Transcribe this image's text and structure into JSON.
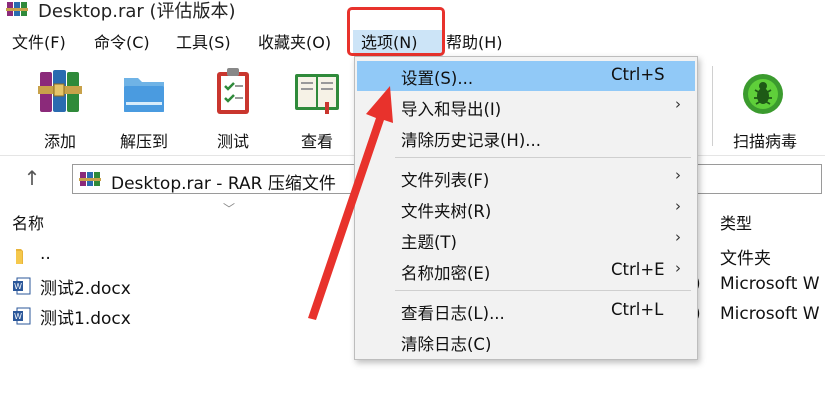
{
  "window": {
    "title": "Desktop.rar (评估版本)"
  },
  "menubar": {
    "items": [
      {
        "label": "文件(F)"
      },
      {
        "label": "命令(C)"
      },
      {
        "label": "工具(S)"
      },
      {
        "label": "收藏夹(O)"
      },
      {
        "label": "选项(N)"
      },
      {
        "label": "帮助(H)"
      }
    ]
  },
  "toolbar": {
    "buttons": [
      {
        "label": "添加",
        "icon": "add-archive-icon"
      },
      {
        "label": "解压到",
        "icon": "extract-folder-icon"
      },
      {
        "label": "测试",
        "icon": "test-clipboard-icon"
      },
      {
        "label": "查看",
        "icon": "view-book-icon"
      },
      {
        "label": "扫描病毒",
        "icon": "virus-scan-icon"
      }
    ]
  },
  "address": {
    "text": "Desktop.rar - RAR 压缩文件"
  },
  "filelist": {
    "headers": {
      "name": "名称",
      "type": "类型"
    },
    "rows": [
      {
        "name": "..",
        "type": "文件夹",
        "icon": "folder-icon",
        "mid": ""
      },
      {
        "name": "测试2.docx",
        "type": "Microsoft W",
        "icon": "word-doc-icon",
        "mid": ")"
      },
      {
        "name": "测试1.docx",
        "type": "Microsoft W",
        "icon": "word-doc-icon",
        "mid": ")"
      }
    ]
  },
  "dropdown": {
    "items": [
      {
        "label": "设置(S)...",
        "shortcut": "Ctrl+S",
        "submenu": false,
        "highlighted": true
      },
      {
        "label": "导入和导出(I)",
        "shortcut": "",
        "submenu": true
      },
      {
        "label": "清除历史记录(H)...",
        "shortcut": "",
        "submenu": false
      },
      {
        "label": "文件列表(F)",
        "shortcut": "",
        "submenu": true
      },
      {
        "label": "文件夹树(R)",
        "shortcut": "",
        "submenu": true
      },
      {
        "label": "主题(T)",
        "shortcut": "",
        "submenu": true
      },
      {
        "label": "名称加密(E)",
        "shortcut": "Ctrl+E",
        "submenu": true
      },
      {
        "label": "查看日志(L)...",
        "shortcut": "Ctrl+L",
        "submenu": false
      },
      {
        "label": "清除日志(C)",
        "shortcut": "",
        "submenu": false
      }
    ]
  },
  "colors": {
    "highlight": "#91c9f7",
    "annotation": "#e8322c",
    "menu_bg": "#f2f2f2"
  }
}
